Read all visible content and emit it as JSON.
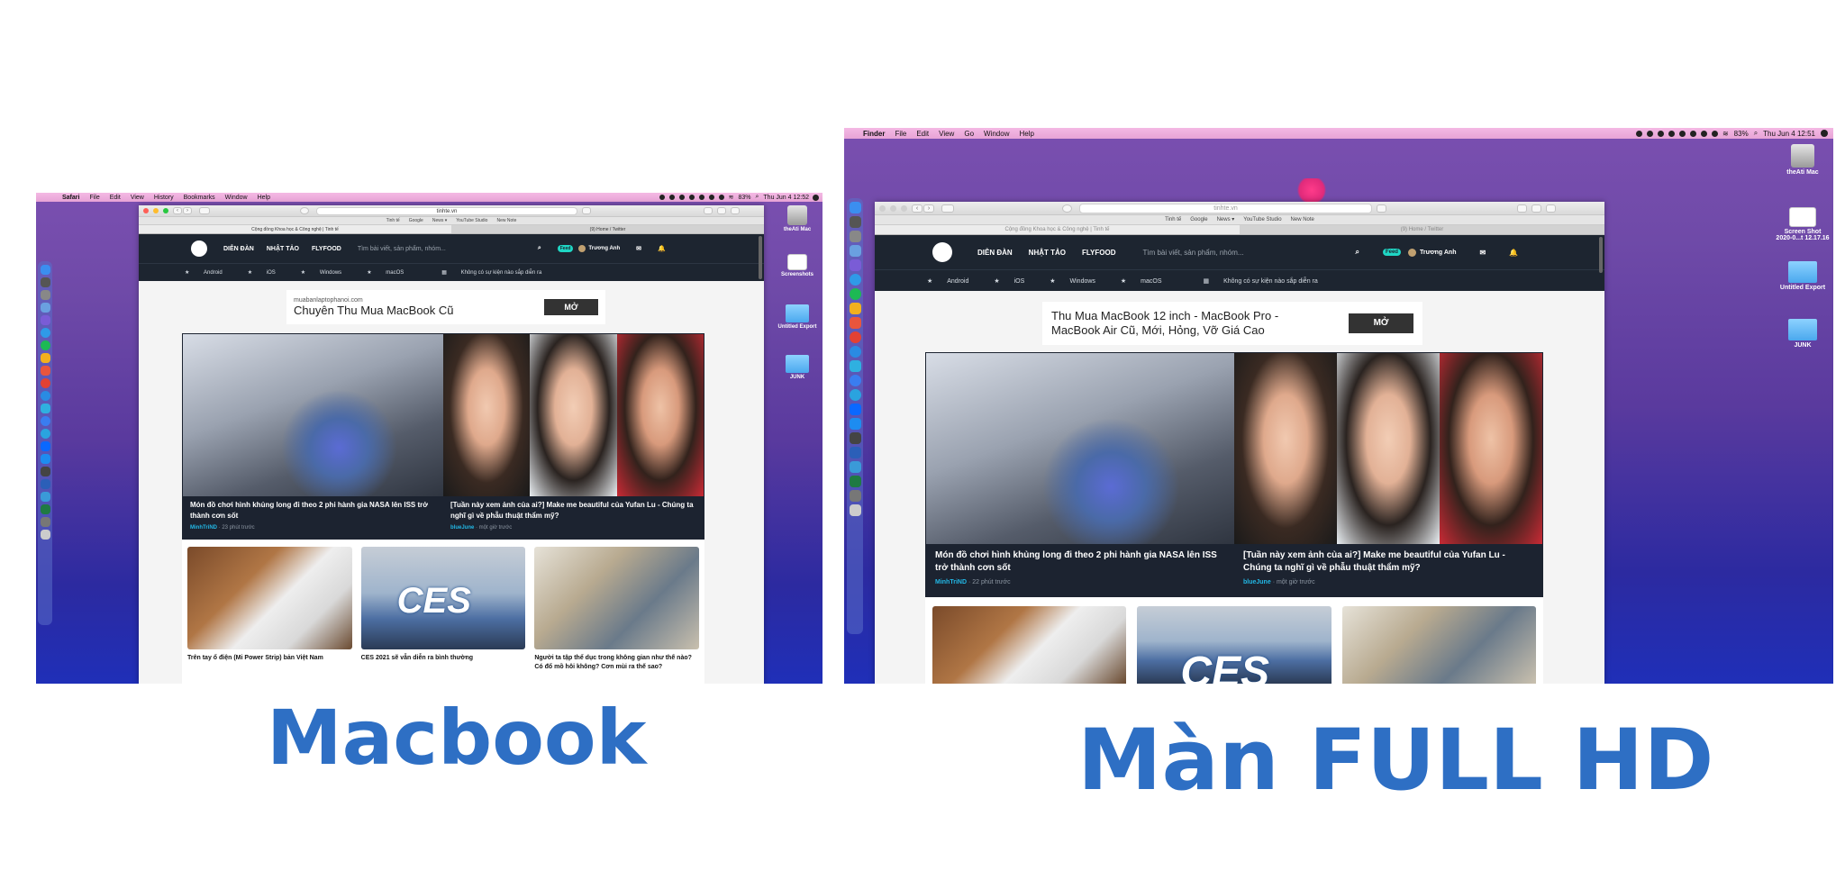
{
  "colors": {
    "accent_label": "#2e6fc4",
    "site_nav": "#1d2530",
    "author": "#22b8e6",
    "menubar": "#f0b3e0"
  },
  "left": {
    "menubar": {
      "apple": "",
      "app": "Safari",
      "items": [
        "File",
        "Edit",
        "View",
        "History",
        "Bookmarks",
        "Window",
        "Help"
      ],
      "battery": "83%",
      "clock": "Thu Jun 4 12:52"
    },
    "desktop": [
      "theAti Mac",
      "Screenshots",
      "Untitled Export",
      "JUNK"
    ],
    "browser": {
      "url": "tinhte.vn",
      "favorites": [
        "Tinh tế",
        "Google",
        "News ▾",
        "YouTube Studio",
        "New Note"
      ],
      "tabs": [
        "Cộng đồng Khoa học & Công nghệ | Tinh tế",
        "(9) Home / Twitter"
      ],
      "nav": [
        "DIỄN ĐÀN",
        "NHẬT TẢO",
        "FLYFOOD"
      ],
      "search_placeholder": "Tìm bài viết, sản phẩm, nhóm...",
      "feed_badge": "Feed",
      "user": "Trương Anh",
      "subnav": [
        "Android",
        "iOS",
        "Windows",
        "macOS"
      ],
      "events": "Không có sự kiện nào sắp diễn ra",
      "ad": {
        "domain": "muabanlaptophanoi.com",
        "title": "Chuyên Thu Mua MacBook Cũ",
        "button": "MỞ"
      },
      "featured": [
        {
          "title": "Món đồ chơi hình khủng long đi theo 2 phi hành gia NASA lên ISS trở thành cơn sốt",
          "author": "MinhTriND",
          "time": "· 23 phút trước"
        },
        {
          "title": "[Tuần này xem ảnh của ai?] Make me beautiful của Yufan Lu - Chúng ta nghĩ gì về phẫu thuật thẩm mỹ?",
          "author": "blueJune",
          "time": "· một giờ trước"
        }
      ],
      "cards": [
        {
          "title": "Trên tay ổ điện (Mi Power Strip) bản Việt Nam"
        },
        {
          "title": "CES 2021 sẽ vẫn diễn ra bình thường"
        },
        {
          "title": "Người ta tập thể dục trong không gian như thế nào? Có đổ mồ hôi không? Cơn mùi ra thế sao?"
        }
      ],
      "ces_logo": "CES"
    }
  },
  "right": {
    "menubar": {
      "apple": "",
      "app": "Finder",
      "items": [
        "File",
        "Edit",
        "View",
        "Go",
        "Window",
        "Help"
      ],
      "battery": "83%",
      "clock": "Thu Jun 4 12:51"
    },
    "desktop": [
      "theAti Mac",
      "Screen Shot 2020-0...t 12.17.16",
      "Untitled Export",
      "JUNK"
    ],
    "browser": {
      "url": "tinhte.vn",
      "favorites": [
        "Tinh tế",
        "Google",
        "News ▾",
        "YouTube Studio",
        "New Note"
      ],
      "tabs": [
        "Cộng đồng Khoa học & Công nghệ | Tinh tế",
        "(9) Home / Twitter"
      ],
      "nav": [
        "DIỄN ĐÀN",
        "NHẬT TẢO",
        "FLYFOOD"
      ],
      "search_placeholder": "Tìm bài viết, sản phẩm, nhóm...",
      "feed_badge": "Feed",
      "user": "Trương Anh",
      "subnav": [
        "Android",
        "iOS",
        "Windows",
        "macOS"
      ],
      "events": "Không có sự kiện nào sắp diễn ra",
      "ad": {
        "line1": "Thu Mua MacBook 12 inch - MacBook Pro -",
        "line2": "MacBook Air Cũ, Mới, Hỏng, Vỡ Giá Cao",
        "button": "MỞ"
      },
      "featured": [
        {
          "title": "Món đồ chơi hình khủng long đi theo 2 phi hành gia NASA lên ISS trở thành cơn sốt",
          "author": "MinhTriND",
          "time": "· 22 phút trước"
        },
        {
          "title": "[Tuần này xem ảnh của ai?] Make me beautiful của Yufan Lu - Chúng ta nghĩ gì về phẫu thuật thẩm mỹ?",
          "author": "blueJune",
          "time": "· một giờ trước"
        }
      ],
      "ces_logo": "CES"
    }
  },
  "labels": {
    "left": "Macbook",
    "right": "Màn FULL HD"
  }
}
